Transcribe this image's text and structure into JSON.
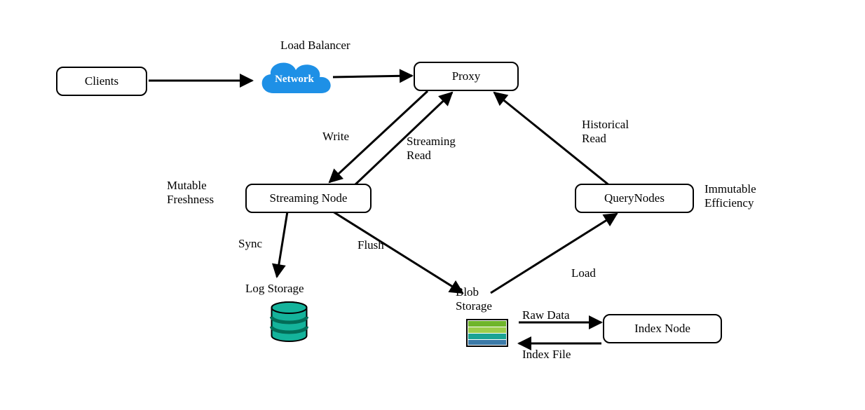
{
  "nodes": {
    "clients": "Clients",
    "proxy": "Proxy",
    "streaming_node": "Streaming Node",
    "query_nodes": "QueryNodes",
    "index_node": "Index Node"
  },
  "cloud": {
    "top_label": "Load Balancer",
    "text": "Network"
  },
  "edges": {
    "write": "Write",
    "streaming_read": "Streaming\nRead",
    "historical_read": "Historical\nRead",
    "sync": "Sync",
    "flush": "Flush",
    "load": "Load",
    "raw_data": "Raw Data",
    "index_file": "Index File"
  },
  "annotations": {
    "mutable_freshness": "Mutable\nFreshness",
    "immutable_efficiency": "Immutable\nEfficiency",
    "log_storage": "Log Storage",
    "blob_storage": "Blob\nStorage"
  },
  "colors": {
    "cloud": "#1e90e6",
    "db_body": "#14b39b",
    "db_stripe": "#036d58",
    "blob_green1": "#6fb52a",
    "blob_green2": "#9ccd4a",
    "blob_teal": "#1aa394",
    "blob_blue": "#3b7aa8"
  }
}
